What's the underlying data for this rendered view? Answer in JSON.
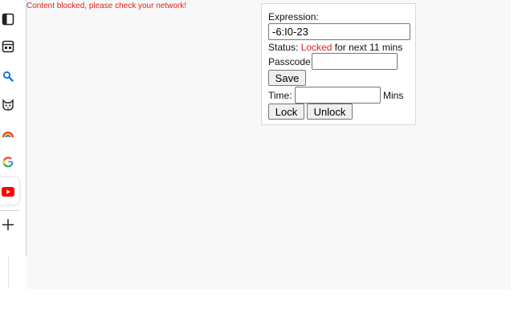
{
  "banner": {
    "error": "Content blocked, please check your network!"
  },
  "sidebar": {
    "icons": [
      "sidebar-panel-icon",
      "tab-window-icon",
      "search-icon",
      "cat-face-icon",
      "rainbow-icon",
      "google-icon",
      "youtube-icon",
      "plus-icon"
    ]
  },
  "panel": {
    "expression_label": "Expression:",
    "expression_value": "-6:I0-23",
    "status_prefix": "Status:",
    "status_value": "Locked",
    "status_suffix": "for next 11 mins",
    "passcode_label": "Passcode:",
    "passcode_value": "",
    "save_label": "Save",
    "time_label": "Time:",
    "time_value": "",
    "mins_label": "Mins",
    "lock_label": "Lock",
    "unlock_label": "Unlock"
  },
  "colors": {
    "error": "#e02020",
    "youtube": "#ff0000"
  }
}
